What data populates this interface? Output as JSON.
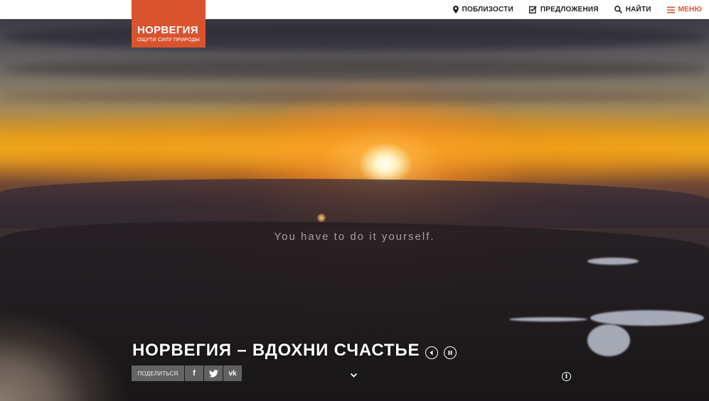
{
  "brand": {
    "title": "НОРВЕГИЯ",
    "subtitle": "ОЩУТИ СИЛУ ПРИРОДЫ",
    "accent_color": "#d9532f"
  },
  "nav": {
    "items": [
      {
        "label": "ПОБЛИЗОСТИ",
        "icon": "location-pin-icon"
      },
      {
        "label": "ПРЕДЛОЖЕНИЯ",
        "icon": "checkbox-icon"
      },
      {
        "label": "НАЙТИ",
        "icon": "search-icon"
      },
      {
        "label": "МЕНЮ",
        "icon": "hamburger-icon"
      }
    ]
  },
  "hero": {
    "video_caption": "You have to do it yourself.",
    "headline": "НОРВЕГИЯ – ВДОХНИ СЧАСТЬЕ",
    "controls": {
      "sound_icon": "speaker-icon",
      "pause_icon": "pause-icon"
    },
    "share": {
      "label": "ПОДЕЛИТЬСЯ",
      "networks": [
        {
          "name": "facebook",
          "glyph": "f",
          "icon": "facebook-icon"
        },
        {
          "name": "twitter",
          "glyph": "",
          "icon": "twitter-icon"
        },
        {
          "name": "vk",
          "glyph": "vk",
          "icon": "vk-icon"
        }
      ]
    },
    "scroll_icon": "chevron-down-icon",
    "info_icon": "info-icon",
    "info_glyph": "i"
  }
}
